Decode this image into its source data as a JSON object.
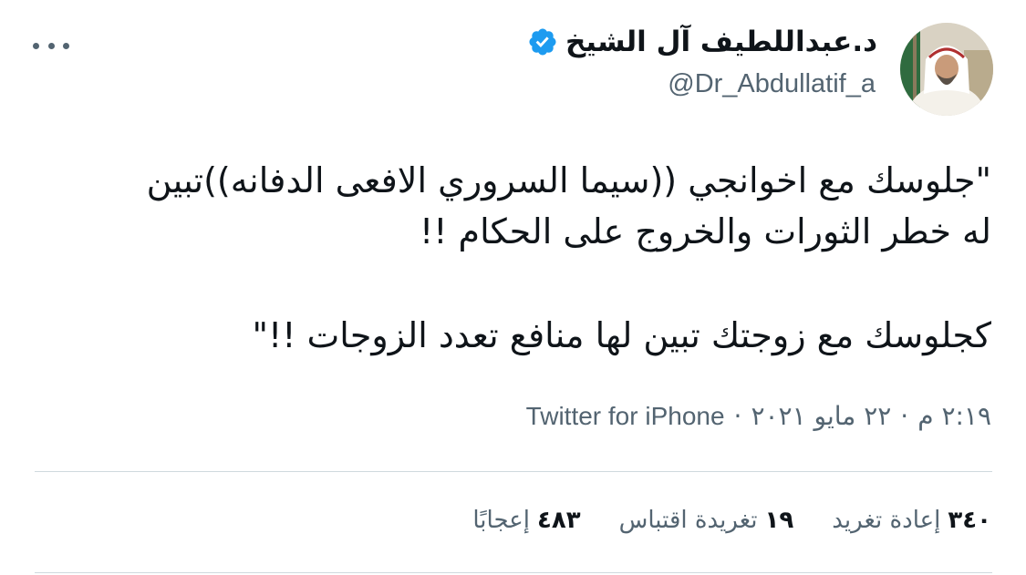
{
  "tweet": {
    "author": {
      "name": "د.عبداللطيف آل الشيخ",
      "handle": "@Dr_Abdullatif_a",
      "verified": true
    },
    "text": {
      "line1": "\"جلوسك مع اخوانجي  ((سيما السروري الافعى الدفانه))تبين",
      "line2": "له خطر الثورات والخروج على الحكام !!",
      "line3": "كجلوسك مع زوجتك تبين لها منافع تعدد الزوجات !!\""
    },
    "meta": {
      "time": "٢:١٩ م",
      "date": "٢٢ مايو ٢٠٢١",
      "separator": "·",
      "source": "Twitter for iPhone"
    },
    "stats": {
      "retweets_count": "٣٤٠",
      "retweets_label": "إعادة تغريد",
      "quotes_count": "١٩",
      "quotes_label": "تغريدة اقتباس",
      "likes_count": "٤٨٣",
      "likes_label": "إعجابًا"
    }
  },
  "colors": {
    "text_primary": "#0f1419",
    "text_secondary": "#536471",
    "verified_blue": "#1d9bf0",
    "divider": "#cfd9de"
  },
  "icons": [
    "more-options-icon",
    "verified-badge-icon",
    "avatar"
  ]
}
